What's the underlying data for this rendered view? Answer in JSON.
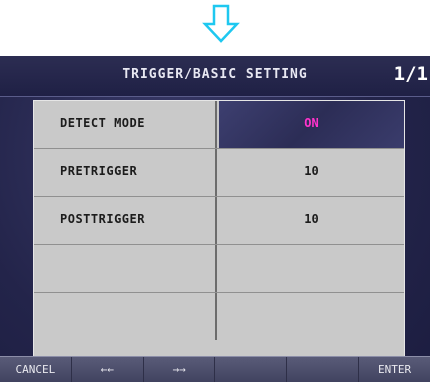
{
  "title": "TRIGGER/BASIC SETTING",
  "page_indicator": "1/1",
  "rows": [
    {
      "label": "DETECT MODE",
      "value": "ON"
    },
    {
      "label": "PRETRIGGER",
      "value": "10"
    },
    {
      "label": "POSTTRIGGER",
      "value": "10"
    },
    {
      "label": "",
      "value": ""
    },
    {
      "label": "",
      "value": ""
    }
  ],
  "footer": {
    "cancel": "CANCEL",
    "prev": "←←",
    "next": "→→",
    "enter": "ENTER"
  },
  "colors": {
    "selected_value": "#ff33cc",
    "arrow": "#33d6ff"
  }
}
